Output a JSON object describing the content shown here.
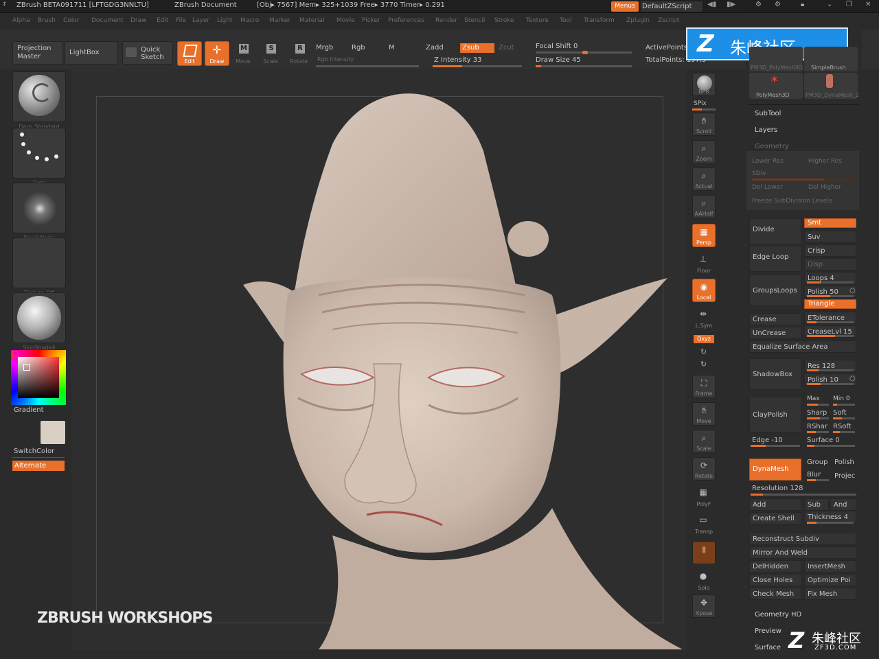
{
  "titlebar": {
    "app": "ZBrush BETA091711 [LFTGDG3NNLTU]",
    "document": "ZBrush Document",
    "stats": "[Obj▸ 7567] Mem▸ 325+1039 Free▸ 3770 Timer▸ 0.291",
    "menus_button": "Menus",
    "script_button": "DefaultZScript"
  },
  "menubar": {
    "items": [
      "Alpha",
      "Brush",
      "Color",
      "Document",
      "Draw",
      "Edit",
      "File",
      "Layer",
      "Light",
      "Macro",
      "Marker",
      "Material",
      "Movie",
      "Picker",
      "Preferences",
      "Render",
      "Stencil",
      "Stroke",
      "Texture",
      "Tool",
      "Transform",
      "Zplugin",
      "Zscript"
    ]
  },
  "toolbar": {
    "projection_master": "Projection Master",
    "lightbox": "LightBox",
    "quick_sketch": "Quick Sketch",
    "edit": "Edit",
    "draw": "Draw",
    "move": "Move",
    "scale": "Scale",
    "rotate": "Rotate",
    "mrgb": "Mrgb",
    "rgb": "Rgb",
    "m": "M",
    "rgb_intensity": "Rgb Intensity",
    "zadd": "Zadd",
    "zsub": "Zsub",
    "zcut": "Zcut",
    "z_intensity": "Z Intensity 33",
    "z_intensity_value": 33,
    "focal_shift": "Focal Shift 0",
    "draw_size": "Draw Size 45",
    "draw_size_value": 45,
    "active_points": "ActivePoints:",
    "total_points": "TotalPoints: 197,9"
  },
  "left_panel": {
    "brush_caption": "Dam_Standard",
    "stroke_caption": "Dots",
    "alpha_caption": "BrushAlpha",
    "texture_caption": "Texture Off",
    "material_caption": "SkinShade4",
    "gradient": "Gradient",
    "switch_color": "SwitchColor",
    "alternate": "Alternate"
  },
  "canvas": {
    "watermark": "ZBRUSH WORKSHOPS"
  },
  "right_tools": {
    "bpr": "BPR",
    "spix": "SPix",
    "scroll": "Scroll",
    "zoom": "Zoom",
    "actual": "Actual",
    "aahalf": "AAHalf",
    "persp": "Persp",
    "floor": "Floor",
    "local": "Local",
    "lsym": "L.Sym",
    "xyz": "Qxyz",
    "frame": "Frame",
    "move": "Move",
    "scale": "Scale",
    "rotate": "Rotate",
    "polyf": "PolyF",
    "transp": "Transp",
    "solo": "Solo",
    "xpose": "Xpose"
  },
  "right_panel": {
    "logo_text": "朱峰社区",
    "subtools_top": [
      "PM3D_PolyMesh3D",
      "SimpleBrush",
      "PolyMesh3D",
      "PM3D_DynaMesh_2"
    ],
    "subtool": "SubTool",
    "layers": "Layers",
    "geometry": "Geometry",
    "geo_dim_rows": [
      "Lower Res",
      "Higher Res",
      "SDiv",
      "Del Lower",
      "Del Higher",
      "Freeze SubDivision Levels"
    ],
    "divide": "Divide",
    "smt": "Smt",
    "suv": "Suv",
    "edge_loop": "Edge Loop",
    "crisp": "Crisp",
    "disp": "Disp",
    "loops": "Loops 4",
    "groups_loops": "GroupsLoops",
    "polish": "Polish 50",
    "triangle": "Triangle",
    "crease": "Crease",
    "etolerance": "ETolerance",
    "uncrease": "UnCrease",
    "crease_lvl": "CreaseLvl 15",
    "equalize": "Equalize Surface Area",
    "shadowbox": "ShadowBox",
    "res": "Res 128",
    "sb_polish": "Polish 10",
    "claypolish": "ClayPolish",
    "max": "Max",
    "min": "Min 0",
    "sharp": "Sharp",
    "soft": "Soft",
    "rsharp": "RShar",
    "rsoft": "RSoft",
    "edge": "Edge -10",
    "surface": "Surface 0",
    "dynamesh": "DynaMesh",
    "group": "Group",
    "dpolish": "Polish",
    "blur": "Blur",
    "project": "Projec",
    "resolution": "Resolution 128",
    "add": "Add",
    "sub": "Sub",
    "and": "And",
    "create_shell": "Create Shell",
    "thickness": "Thickness 4",
    "reconstruct": "Reconstruct Subdiv",
    "mirror_weld": "Mirror And Weld",
    "delhidden": "DelHidden",
    "insertmesh": "InsertMesh",
    "close_holes": "Close Holes",
    "optimize": "Optimize Poi",
    "check_mesh": "Check Mesh",
    "fix_mesh": "Fix Mesh",
    "geometry_hd": "Geometry HD",
    "preview": "Preview",
    "surface_section": "Surface"
  },
  "corner_watermark": {
    "text": "朱峰社区",
    "url": "ZF3D.COM"
  },
  "colors": {
    "accent": "#e8702a",
    "logo_blue": "#1e8fe6",
    "clay": "#d4c3b7"
  }
}
